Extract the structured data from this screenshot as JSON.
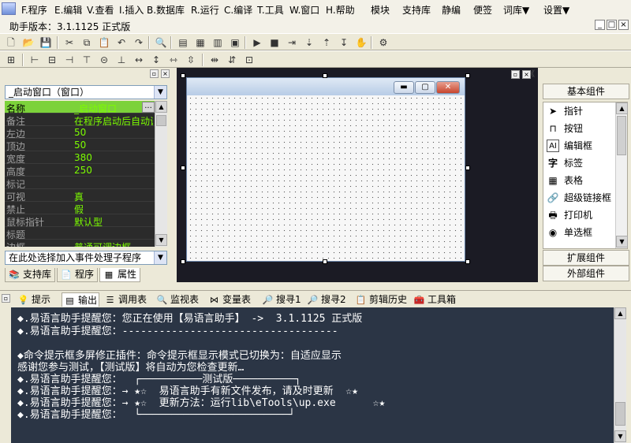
{
  "menu": [
    "F.程序",
    "E.编辑",
    "V.查看",
    "I.插入",
    "B.数据库",
    "R.运行",
    "C.编译",
    "T.工具",
    "W.窗口",
    "H.帮助",
    "模块",
    "支持库",
    "静编",
    "便签",
    "词库▼",
    "设置▼"
  ],
  "version_text": "助手版本：3.1.1125 正式版",
  "window_controls": {
    "min": "_",
    "restore": "□",
    "close": "×"
  },
  "left_panel": {
    "object_select": "_启动窗口（窗口）",
    "properties": [
      {
        "name": "名称",
        "value": "_启动窗口"
      },
      {
        "name": "备注",
        "value": "在程序启动后自动调"
      },
      {
        "name": "左边",
        "value": "50"
      },
      {
        "name": "顶边",
        "value": "50"
      },
      {
        "name": "宽度",
        "value": "380"
      },
      {
        "name": "高度",
        "value": "250"
      },
      {
        "name": "标记",
        "value": ""
      },
      {
        "name": "可视",
        "value": "真"
      },
      {
        "name": "禁止",
        "value": "假"
      },
      {
        "name": "鼠标指针",
        "value": "默认型"
      },
      {
        "name": "标题",
        "value": ""
      },
      {
        "name": "边框",
        "value": "普通可调边框"
      }
    ],
    "ellipsis_label": "...",
    "event_select": "在此处选择加入事件处理子程序",
    "tabs": [
      "支持库",
      "程序",
      "属性"
    ]
  },
  "right_panel": {
    "collapse_label": "《",
    "basic_header": "基本组件",
    "components": [
      "指针",
      "按钮",
      "编辑框",
      "标签",
      "表格",
      "超级链接框",
      "打印机",
      "单选框"
    ],
    "extend_header": "扩展组件",
    "external_header": "外部组件"
  },
  "bottom_tabs": [
    "提示",
    "输出",
    "调用表",
    "监视表",
    "变量表",
    "搜寻1",
    "搜寻2",
    "剪辑历史",
    "工具箱"
  ],
  "output_lines": [
    "◆.易语言助手提醒您：您正在使用【易语言助手】 ->  3.1.1125 正式版",
    "◆.易语言助手提醒您：-----------------------------------",
    "",
    "◆命令提示框多屏修正插件：命令提示框显示模式已切换为：自适应显示",
    "感谢您参与测试，【测试版】将自动为您检查更新…",
    "◆.易语言助手提醒您：  ┌──────────测试版──────────┐",
    "◆.易语言助手提醒您：→ ★☆  易语言助手有新文件发布，请及时更新  ☆★",
    "◆.易语言助手提醒您：→ ★☆  更新方法：运行lib\\eTools\\up.exe      ☆★",
    "◆.易语言助手提醒您：  └────────────────────────┘"
  ]
}
